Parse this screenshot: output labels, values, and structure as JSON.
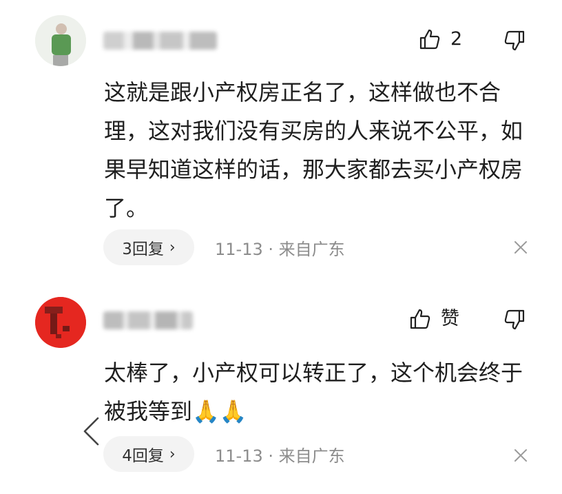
{
  "comments": [
    {
      "like_label": "2",
      "body": "这就是跟小产权房正名了，这样做也不合理，这对我们没有买房的人来说不公平，如果早知道这样的话，那大家都去买小产权房了。",
      "reply_label": "3回复",
      "date": "11-13",
      "location": "来自广东"
    },
    {
      "like_label": "赞",
      "body": "太棒了，小产权可以转正了，这个机会终于被我等到",
      "body_emoji": "🙏🙏",
      "reply_label": "4回复",
      "date": "11-13",
      "location": "来自广东"
    }
  ],
  "meta_separator": "·",
  "icons": {
    "like": "thumbs-up-icon",
    "dislike": "thumbs-down-icon",
    "close": "close-icon",
    "chevron": "chevron-right-icon",
    "back": "back-arrow-icon"
  }
}
